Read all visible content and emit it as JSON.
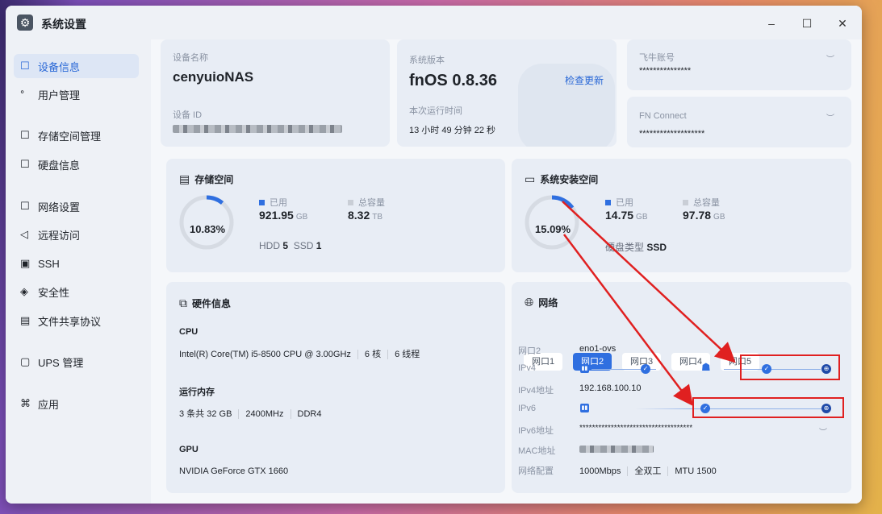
{
  "window": {
    "title": "系统设置",
    "icon": "gear-icon",
    "minimize": "–",
    "maximize": "☐",
    "close": "✕"
  },
  "sidebar": {
    "items": [
      {
        "label": "设备信息",
        "icon": "device-icon",
        "glyph": "☐",
        "active": true
      },
      {
        "label": "用户管理",
        "icon": "user-icon",
        "glyph": "ᐤ"
      },
      {
        "label": "存储空间管理",
        "icon": "storage-icon",
        "glyph": "☐"
      },
      {
        "label": "硬盘信息",
        "icon": "disk-icon",
        "glyph": "☐"
      },
      {
        "label": "网络设置",
        "icon": "network-icon",
        "glyph": "☐"
      },
      {
        "label": "远程访问",
        "icon": "send-icon",
        "glyph": "◁"
      },
      {
        "label": "SSH",
        "icon": "terminal-icon",
        "glyph": "▣"
      },
      {
        "label": "安全性",
        "icon": "shield-icon",
        "glyph": "◈"
      },
      {
        "label": "文件共享协议",
        "icon": "file-icon",
        "glyph": "▤"
      },
      {
        "label": "UPS 管理",
        "icon": "battery-icon",
        "glyph": "▢"
      },
      {
        "label": "应用",
        "icon": "apps-icon",
        "glyph": "⌘"
      }
    ]
  },
  "device": {
    "name_label": "设备名称",
    "name": "cenyuioNAS",
    "id_label": "设备 ID"
  },
  "version": {
    "label": "系统版本",
    "value": "fnOS  0.8.36",
    "check_update": "检查更新",
    "uptime_label": "本次运行时间",
    "uptime": "13 小时 49 分钟 22 秒"
  },
  "accounts": {
    "feiniu_label": "飞牛账号",
    "feiniu_value": "***************",
    "fnconnect_label": "FN Connect",
    "fnconnect_value": "*******************",
    "eye_icon": "eye-closed-icon"
  },
  "storage": {
    "title": "存储空间",
    "percent": "10.83%",
    "used_label": "已用",
    "used_value": "921.95",
    "used_unit": "GB",
    "total_label": "总容量",
    "total_value": "8.32",
    "total_unit": "TB",
    "hdd_label": "HDD",
    "hdd_count": "5",
    "ssd_label": "SSD",
    "ssd_count": "1",
    "used_fraction": 0.1083
  },
  "system_space": {
    "title": "系统安装空间",
    "percent": "15.09%",
    "used_label": "已用",
    "used_value": "14.75",
    "used_unit": "GB",
    "total_label": "总容量",
    "total_value": "97.78",
    "total_unit": "GB",
    "disk_type_label": "硬盘类型",
    "disk_type": "SSD",
    "used_fraction": 0.1509
  },
  "hardware": {
    "title": "硬件信息",
    "cpu_label": "CPU",
    "cpu_model": "Intel(R) Core(TM) i5-8500 CPU @ 3.00GHz",
    "cpu_cores": "6 核",
    "cpu_threads": "6 线程",
    "mem_label": "运行内存",
    "mem_size": "3 条共 32 GB",
    "mem_speed": "2400MHz",
    "mem_type": "DDR4",
    "gpu_label": "GPU",
    "gpu_model": "NVIDIA GeForce GTX 1660"
  },
  "network": {
    "title": "网络",
    "tabs": [
      "网口1",
      "网口2",
      "网口3",
      "网口4",
      "网口5"
    ],
    "active_tab": 1,
    "port_label": "网口2",
    "port_value": "eno1-ovs",
    "ipv4_label": "IPv4",
    "ipv4_addr_label": "IPv4地址",
    "ipv4_addr": "192.168.100.10",
    "ipv6_label": "IPv6",
    "ipv6_addr_label": "IPv6地址",
    "ipv6_addr": "************************************",
    "mac_label": "MAC地址",
    "config_label": "网络配置",
    "speed": "1000Mbps",
    "duplex": "全双工",
    "mtu": "MTU 1500"
  },
  "colors": {
    "accent": "#2f6fe0",
    "annotation": "#e02020"
  }
}
